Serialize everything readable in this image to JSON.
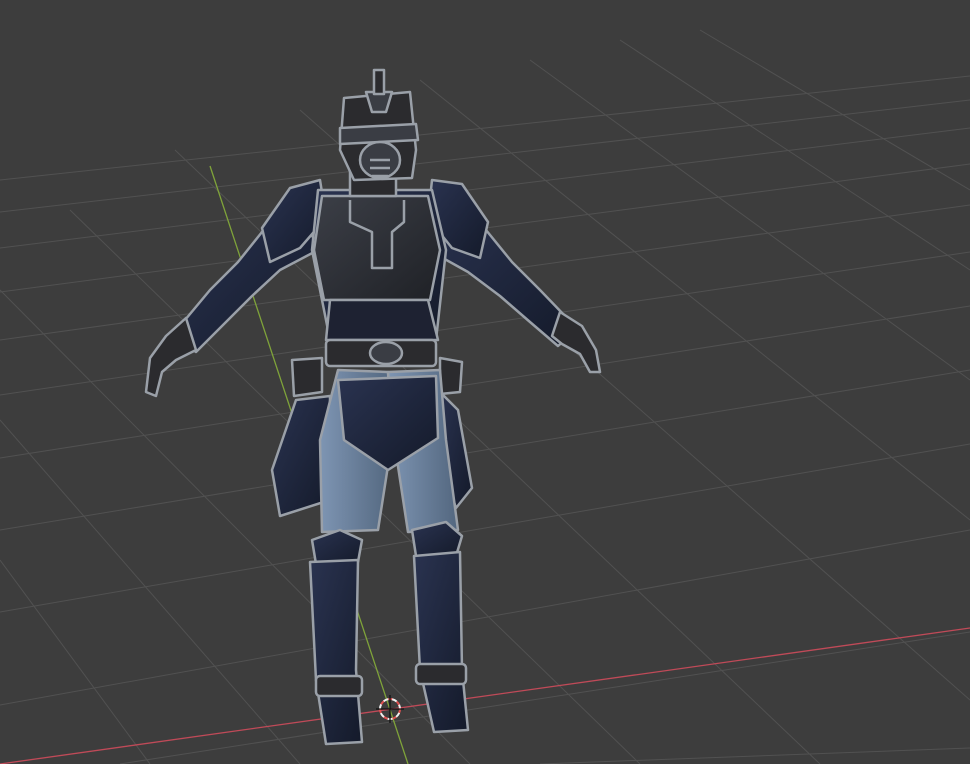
{
  "viewport": {
    "type": "3d-viewport",
    "background": "#3d3d3d",
    "grid_color": "#555555",
    "x_axis_color": "#c04a58",
    "y_axis_color": "#7fa33a"
  },
  "scene": {
    "object": "armored-character-model",
    "pose": "t-pose",
    "colors": {
      "armor": "#1c2336",
      "armor_trim": "#9aa0a8",
      "pants": "#6a82a0",
      "metal": "#2b2b2e"
    }
  },
  "cursor_3d": {
    "icon": "3d-cursor-icon"
  }
}
